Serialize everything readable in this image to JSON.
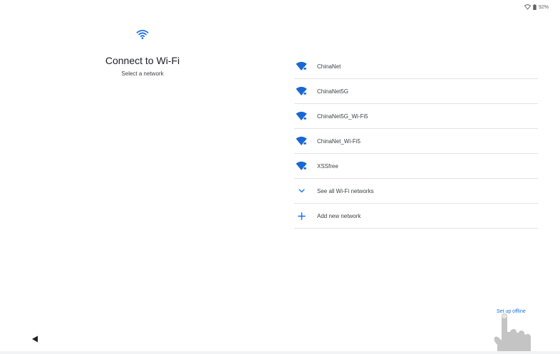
{
  "status_bar": {
    "battery": "92%",
    "icons": [
      "wifi-icon",
      "battery-icon"
    ]
  },
  "header": {
    "icon": "wifi-icon",
    "title": "Connect to Wi-Fi",
    "subtitle": "Select a network"
  },
  "networks": [
    {
      "name": "ChinaNet",
      "icon": "wifi-lock-icon"
    },
    {
      "name": "ChinaNet5G",
      "icon": "wifi-lock-icon"
    },
    {
      "name": "ChinaNet5G_Wi-Fi5",
      "icon": "wifi-lock-icon"
    },
    {
      "name": "ChinaNet_Wi-Fi5",
      "icon": "wifi-lock-icon"
    },
    {
      "name": "XSSfree",
      "icon": "wifi-lock-icon"
    }
  ],
  "actions": {
    "see_all": "See all Wi-Fi networks",
    "add_new": "Add new network"
  },
  "footer": {
    "setup_offline": "Set up offline"
  },
  "colors": {
    "accent": "#1a73e8",
    "wifi_icon": "#1967d2",
    "divider": "#e3e3e3"
  }
}
